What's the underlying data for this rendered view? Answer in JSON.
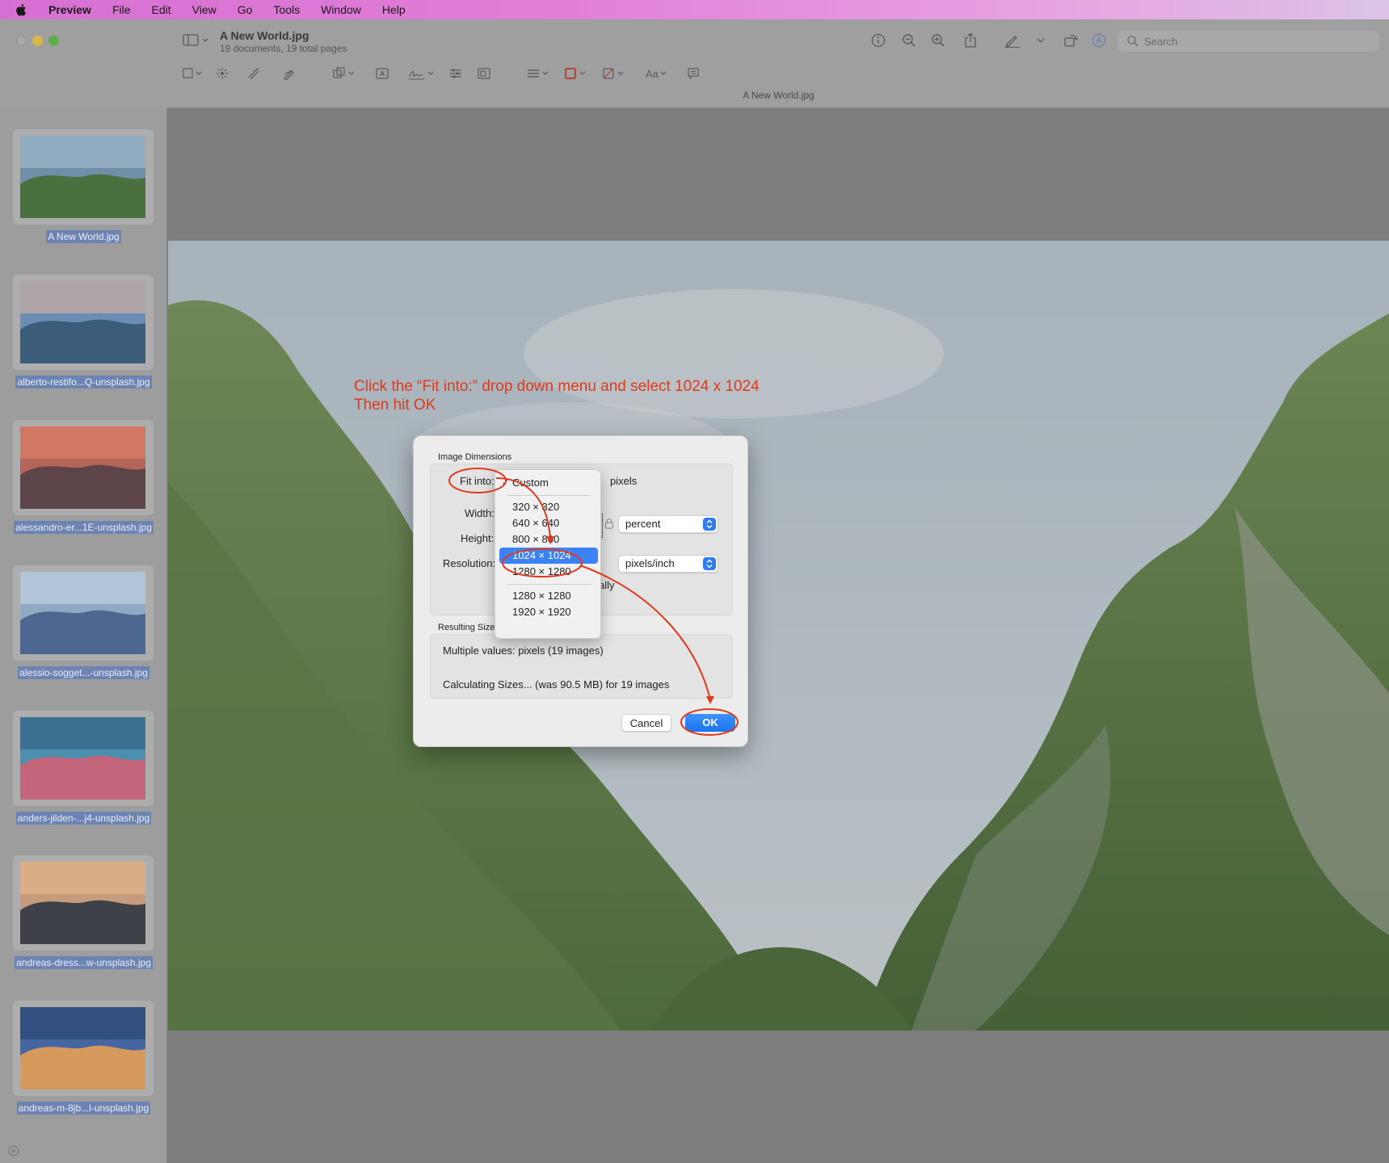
{
  "menubar": {
    "app": "Preview",
    "items": [
      "File",
      "Edit",
      "View",
      "Go",
      "Tools",
      "Window",
      "Help"
    ]
  },
  "window": {
    "title": "A New World.jpg",
    "subtitle": "19 documents, 19 total pages",
    "image_label": "A New World.jpg",
    "search_placeholder": "Search"
  },
  "sidebar": {
    "items": [
      {
        "label": "A New World.jpg",
        "colors": [
          "#6f8fa8",
          "#4b7040",
          "#a8c0d0"
        ]
      },
      {
        "label": "alberto-restifo...Q-unsplash.jpg",
        "colors": [
          "#6c8db3",
          "#3c5d7a",
          "#d8b6a0"
        ]
      },
      {
        "label": "alessandro-er...1E-unsplash.jpg",
        "colors": [
          "#b5645a",
          "#5c4448",
          "#e4836a"
        ]
      },
      {
        "label": "alessio-sogget...-unsplash.jpg",
        "colors": [
          "#8fa8c4",
          "#4e6790",
          "#c9d7e6"
        ]
      },
      {
        "label": "anders-jilden-...j4-unsplash.jpg",
        "colors": [
          "#4c8fae",
          "#c4667b",
          "#2e5c7c"
        ]
      },
      {
        "label": "andreas-dress...w-unsplash.jpg",
        "colors": [
          "#c69d7c",
          "#3f4148",
          "#e6b98b"
        ]
      },
      {
        "label": "andreas-m-8jb...l-unsplash.jpg",
        "colors": [
          "#4566a0",
          "#d59a5c",
          "#27406b"
        ]
      }
    ]
  },
  "instruction": {
    "line1": "Click the “Fit into:” drop down menu and select 1024 x 1024",
    "line2": "Then hit OK"
  },
  "dialog": {
    "image_dimensions_title": "Image Dimensions",
    "fit_into_label": "Fit into:",
    "pixels_label": "pixels",
    "width_label": "Width:",
    "height_label": "Height:",
    "resolution_label": "Resolution:",
    "width_unit": "percent",
    "resolution_unit": "pixels/inch",
    "scale_partial": "ally",
    "resulting_size_title": "Resulting Size",
    "resulting_values": "Multiple values: pixels (19 images)",
    "calculating": "Calculating Sizes... (was 90.5 MB) for 19 images",
    "cancel": "Cancel",
    "ok": "OK"
  },
  "fit_menu": {
    "checked_item": "Custom",
    "items": [
      "320 × 320",
      "640 × 640",
      "800 × 800",
      "1024 × 1024",
      "1280 × 1280"
    ],
    "extra_items": [
      "1280 × 1280",
      "1920 × 1920"
    ],
    "selected": "1024 × 1024"
  },
  "colors": {
    "annotation_red": "#e03a1e",
    "accent_blue": "#1a74f0"
  }
}
